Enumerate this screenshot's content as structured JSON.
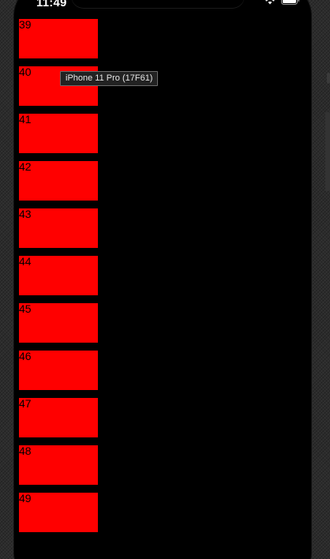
{
  "status_bar": {
    "time": "11:49",
    "icons": [
      "wifi-icon",
      "battery-icon"
    ]
  },
  "tooltip": {
    "text": "iPhone 11 Pro (17F61)"
  },
  "cells": [
    {
      "label": "39"
    },
    {
      "label": "40"
    },
    {
      "label": "41"
    },
    {
      "label": "42"
    },
    {
      "label": "43"
    },
    {
      "label": "44"
    },
    {
      "label": "45"
    },
    {
      "label": "46"
    },
    {
      "label": "47"
    },
    {
      "label": "48"
    },
    {
      "label": "49"
    }
  ],
  "colors": {
    "cell_background": "#ff0000",
    "screen_background": "#000000",
    "label_color": "#000000"
  }
}
